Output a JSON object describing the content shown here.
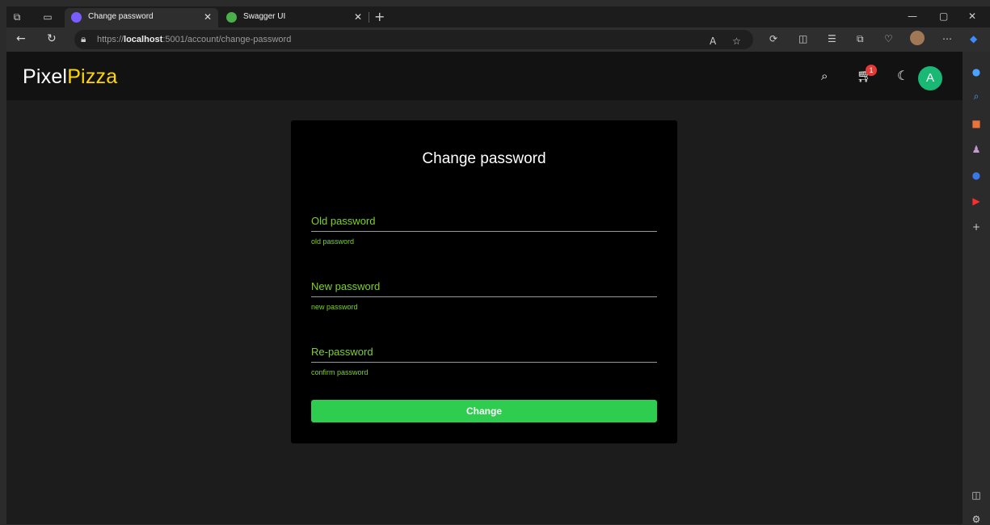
{
  "browser": {
    "tabs": [
      {
        "title": "Change password",
        "favicon_color": "#7a5cff",
        "active": true
      },
      {
        "title": "Swagger UI",
        "favicon_color": "#49b04a",
        "active": false
      }
    ],
    "url_prefix": "https://",
    "url_host": "localhost",
    "url_rest": ":5001/account/change-password"
  },
  "app": {
    "logo_part1": "Pixel",
    "logo_part2": "Pizza",
    "cart_count": "1",
    "avatar_letter": "A"
  },
  "form": {
    "title": "Change password",
    "old_password": {
      "label": "Old password",
      "hint": "old password"
    },
    "new_password": {
      "label": "New password",
      "hint": "new password"
    },
    "re_password": {
      "label": "Re-password",
      "hint": "confirm password"
    },
    "submit_label": "Change"
  },
  "colors": {
    "accent_green": "#7ed321",
    "button_green": "#2ecc4f",
    "logo_yellow": "#ffd700",
    "avatar_green": "#19b874",
    "badge_red": "#e53935"
  },
  "icons": {
    "search": "search-icon",
    "cart": "cart-icon",
    "theme": "moon-icon"
  }
}
